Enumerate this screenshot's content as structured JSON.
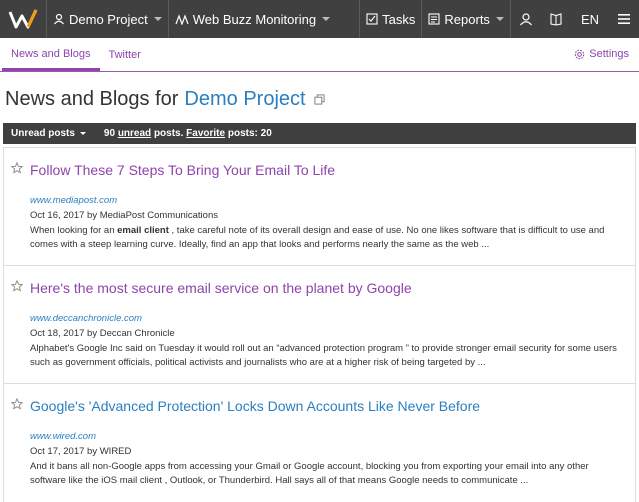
{
  "topbar": {
    "project_label": "Demo Project",
    "module_label": "Web Buzz Monitoring",
    "tasks_label": "Tasks",
    "reports_label": "Reports",
    "lang_label": "EN"
  },
  "subtabs": {
    "news_label": "News and Blogs",
    "twitter_label": "Twitter",
    "settings_label": "Settings"
  },
  "page": {
    "title_prefix": "News and Blogs for",
    "project": "Demo Project"
  },
  "filter": {
    "unread_label": "Unread posts",
    "count": "90",
    "unread_word": "unread",
    "posts_word": "posts.",
    "favorite_word": "Favorite",
    "favorite_rest": "posts: 20"
  },
  "items": [
    {
      "title": "Follow These 7 Steps To Bring Your Email To Life",
      "source": "www.mediapost.com",
      "meta": "Oct 16, 2017 by MediaPost Communications",
      "snippet_pre": "When looking for an ",
      "snippet_bold": "email client",
      "snippet_post": " , take careful note of its overall design and ease of use. No one likes software that is difficult to use and comes with a steep learning curve. Ideally, find an app that looks and performs nearly the same as the web ..."
    },
    {
      "title": "Here's the most secure email service on the planet by Google",
      "source": "www.deccanchronicle.com",
      "meta": "Oct 18, 2017 by Deccan Chronicle",
      "snippet": "Alphabet's Google Inc said on Tuesday it would roll out an “advanced protection program ” to provide stronger email security for some users such as government officials, political activists and journalists who are at a higher risk of being targeted by ..."
    },
    {
      "title": "Google's 'Advanced Protection' Locks Down Accounts Like Never Before",
      "source": "www.wired.com",
      "meta": "Oct 17, 2017 by WIRED",
      "snippet": "And it bans all non-Google apps from accessing your Gmail or Google account, blocking you from exporting your email into any other software like the iOS mail client , Outlook, or Thunderbird. Hall says all of that means Google needs to communicate ..."
    }
  ],
  "colors": {
    "topbar": "#404040",
    "accent": "#8e44ad",
    "link": "#2a7fc0"
  }
}
